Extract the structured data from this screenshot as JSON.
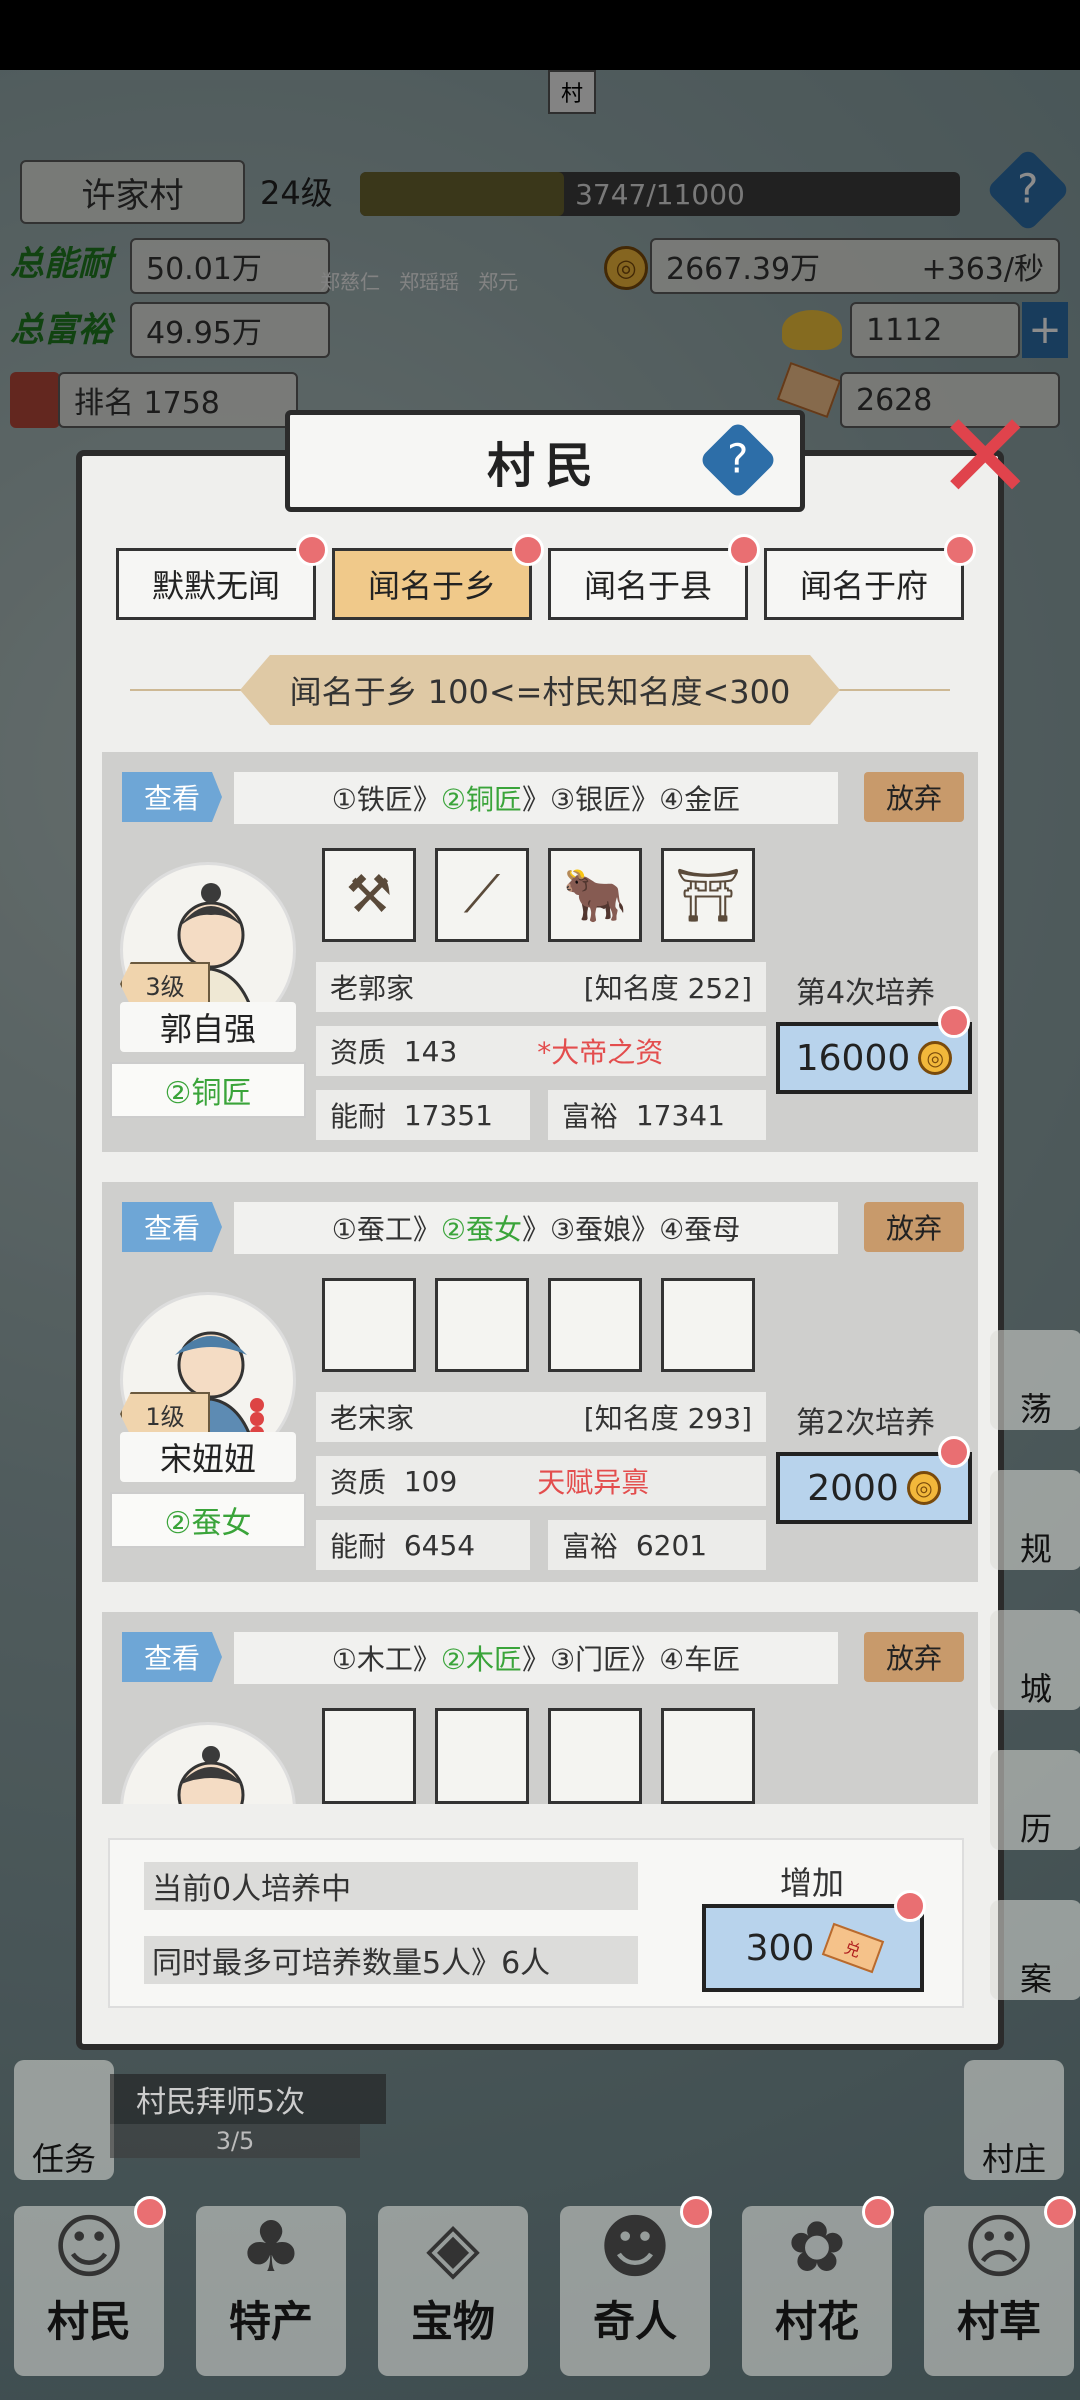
{
  "hud": {
    "village_name": "许家村",
    "village_level": "24级",
    "exp_text": "3747/11000",
    "exp_fraction": 0.34,
    "total_ability_value": "50.01万",
    "names": [
      "郑慈仁",
      "郑瑶瑶",
      "郑元"
    ],
    "coins": "2667.39万",
    "coin_rate": "+363/秒",
    "total_wealth_value": "49.95万",
    "gold": "1112",
    "rank": "排名 1758",
    "tickets": "2628",
    "top_tag": "村"
  },
  "dialog": {
    "title": "村民",
    "tabs": [
      {
        "label": "默默无闻",
        "active": false
      },
      {
        "label": "闻名于乡",
        "active": true
      },
      {
        "label": "闻名于县",
        "active": false
      },
      {
        "label": "闻名于府",
        "active": false
      }
    ],
    "rank_banner": "闻名于乡  100<=村民知名度<300",
    "view_label": "查看",
    "abandon_label": "放弃",
    "villagers": [
      {
        "path": {
          "p1": "①铁匠",
          "p2": "②铜匠",
          "p3": "③银匠",
          "p4": "④金匠"
        },
        "slots": [
          "tool",
          "tool",
          "tool",
          "tool"
        ],
        "level": "3级",
        "name": "郭自强",
        "job": "②铜匠",
        "family": "老郭家",
        "fame": "[知名度 252]",
        "aptitude_label": "资质",
        "aptitude": "143",
        "talent": "*大帝之资",
        "ability_label": "能耐",
        "ability": "17351",
        "wealth_label": "富裕",
        "wealth": "17341",
        "train_times": "第4次培养",
        "cost": "16000"
      },
      {
        "path": {
          "p1": "①蚕工",
          "p2": "②蚕女",
          "p3": "③蚕娘",
          "p4": "④蚕母"
        },
        "level": "1级",
        "name": "宋妞妞",
        "job": "②蚕女",
        "family": "老宋家",
        "fame": "[知名度 293]",
        "aptitude_label": "资质",
        "aptitude": "109",
        "talent": "天赋异禀",
        "ability_label": "能耐",
        "ability": "6454",
        "wealth_label": "富裕",
        "wealth": "6201",
        "train_times": "第2次培养",
        "cost": "2000"
      },
      {
        "path": {
          "p1": "①木工",
          "p2": "②木匠",
          "p3": "③门匠",
          "p4": "④车匠"
        }
      }
    ],
    "training_now": "当前0人培养中",
    "max_training": "同时最多可培养数量5人》6人",
    "increase_label": "增加",
    "increase_cost": "300",
    "ticket_text": "兑"
  },
  "quest": {
    "label": "任务",
    "text": "村民拜师5次",
    "progress": "3/5"
  },
  "side_right": [
    "荡",
    "规",
    "城",
    "历",
    "案",
    "村庄"
  ],
  "nav": [
    "村民",
    "特产",
    "宝物",
    "奇人",
    "村花",
    "村草"
  ]
}
